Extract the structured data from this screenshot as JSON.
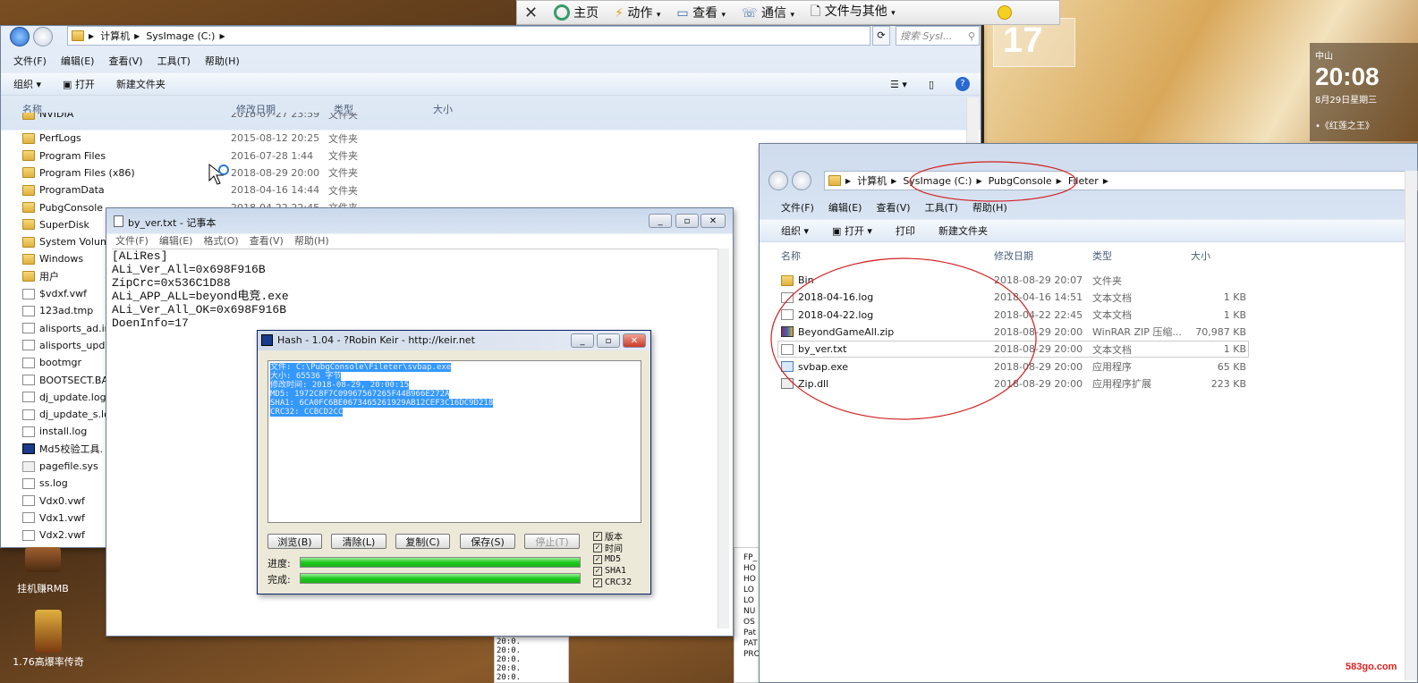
{
  "top_toolbar": {
    "close": "✕",
    "home": "主页",
    "action": "动作",
    "view": "查看",
    "comm": "通信",
    "files_other": "文件与其他"
  },
  "desktop": {
    "clock": "20:08",
    "city": "中山",
    "date": "8月29日星期三",
    "song": "•《红莲之王》",
    "icon1_label": "挂机赚RMB",
    "icon2_label": "1.76高爆率传奇",
    "watermark": "583go.com",
    "partial_number": "17"
  },
  "explorer1": {
    "breadcrumb": [
      "计算机",
      "SysImage (C:)"
    ],
    "search_placeholder": "搜索 SysI...",
    "menu": [
      "文件(F)",
      "编辑(E)",
      "查看(V)",
      "工具(T)",
      "帮助(H)"
    ],
    "toolbar": {
      "organize": "组织 ▾",
      "open": "打开",
      "new_folder": "新建文件夹"
    },
    "columns": {
      "name": "名称",
      "modified": "修改日期",
      "type": "类型",
      "size": "大小"
    },
    "rows": [
      {
        "name": "NVIDIA",
        "date": "2018-07-27 23:59",
        "type": "文件夹",
        "icon": "folder"
      },
      {
        "name": "PerfLogs",
        "date": "2015-08-12 20:25",
        "type": "文件夹",
        "icon": "folder"
      },
      {
        "name": "Program Files",
        "date": "2016-07-28 1:44",
        "type": "文件夹",
        "icon": "folder"
      },
      {
        "name": "Program Files (x86)",
        "date": "2018-08-29 20:00",
        "type": "文件夹",
        "icon": "folder"
      },
      {
        "name": "ProgramData",
        "date": "2018-04-16 14:44",
        "type": "文件夹",
        "icon": "folder"
      },
      {
        "name": "PubgConsole",
        "date": "2018-04-22 22:45",
        "type": "文件夹",
        "icon": "folder"
      },
      {
        "name": "SuperDisk",
        "date": "",
        "type": "",
        "icon": "folder"
      },
      {
        "name": "System Volum",
        "date": "",
        "type": "",
        "icon": "folder"
      },
      {
        "name": "Windows",
        "date": "",
        "type": "",
        "icon": "folder"
      },
      {
        "name": "用户",
        "date": "",
        "type": "",
        "icon": "folder"
      },
      {
        "name": "$vdxf.vwf",
        "date": "",
        "type": "",
        "icon": "file"
      },
      {
        "name": "123ad.tmp",
        "date": "",
        "type": "",
        "icon": "file"
      },
      {
        "name": "alisports_ad.ir",
        "date": "",
        "type": "",
        "icon": "file"
      },
      {
        "name": "alisports_upd",
        "date": "",
        "type": "",
        "icon": "file"
      },
      {
        "name": "bootmgr",
        "date": "",
        "type": "",
        "icon": "file"
      },
      {
        "name": "BOOTSECT.BA",
        "date": "",
        "type": "",
        "icon": "file"
      },
      {
        "name": "dj_update.log",
        "date": "",
        "type": "",
        "icon": "file"
      },
      {
        "name": "dj_update_s.lo",
        "date": "",
        "type": "",
        "icon": "file"
      },
      {
        "name": "install.log",
        "date": "",
        "type": "",
        "icon": "file"
      },
      {
        "name": "Md5校验工具.",
        "date": "",
        "type": "",
        "icon": "md5"
      },
      {
        "name": "pagefile.sys",
        "date": "",
        "type": "",
        "icon": "sys"
      },
      {
        "name": "ss.log",
        "date": "",
        "type": "",
        "icon": "file"
      },
      {
        "name": "Vdx0.vwf",
        "date": "",
        "type": "",
        "icon": "file"
      },
      {
        "name": "Vdx1.vwf",
        "date": "",
        "type": "",
        "icon": "file"
      },
      {
        "name": "Vdx2.vwf",
        "date": "",
        "type": "",
        "icon": "file"
      }
    ]
  },
  "notepad": {
    "title": "by_ver.txt - 记事本",
    "menu": [
      "文件(F)",
      "编辑(E)",
      "格式(O)",
      "查看(V)",
      "帮助(H)"
    ],
    "lines": [
      "[ALiRes]",
      "ALi_Ver_All=0x698F916B",
      "ZipCrc=0x536C1D88",
      "ALi_APP_ALL=beyond电竞.exe",
      "ALi_Ver_All_OK=0x698F916B",
      "DoenInfo=17"
    ]
  },
  "hash": {
    "title": "Hash - 1.04 - ?Robin Keir - http://keir.net",
    "lines": [
      "文件: C:\\PubgConsole\\Fileter\\svbap.exe",
      "大小: 65536 字节",
      "修改时间: 2018-08-29, 20:00:15",
      "MD5: 1972C8F7C09967567265F44B966E272A",
      "SHA1: 6CA0FC6BE0673465261929AB12CEF3C16DC9D218",
      "CRC32: CCBCD2CC"
    ],
    "buttons": {
      "browse": "浏览(B)",
      "clear": "清除(L)",
      "copy": "复制(C)",
      "save": "保存(S)",
      "stop": "停止(T)"
    },
    "checks": [
      "版本",
      "时间",
      "MD5",
      "SHA1",
      "CRC32"
    ],
    "progress_label": "进度:",
    "done_label": "完成:",
    "progress": 1.0,
    "done": 1.0
  },
  "explorer2": {
    "breadcrumb": [
      "计算机",
      "SysImage (C:)",
      "PubgConsole",
      "Fileter"
    ],
    "menu": [
      "文件(F)",
      "编辑(E)",
      "查看(V)",
      "工具(T)",
      "帮助(H)"
    ],
    "toolbar": {
      "organize": "组织 ▾",
      "open": "打开 ▾",
      "print": "打印",
      "new_folder": "新建文件夹"
    },
    "columns": {
      "name": "名称",
      "modified": "修改日期",
      "type": "类型",
      "size": "大小"
    },
    "rows": [
      {
        "name": "Bin",
        "date": "2018-08-29 20:07",
        "type": "文件夹",
        "size": "",
        "icon": "folder"
      },
      {
        "name": "2018-04-16.log",
        "date": "2018-04-16 14:51",
        "type": "文本文档",
        "size": "1 KB",
        "icon": "file"
      },
      {
        "name": "2018-04-22.log",
        "date": "2018-04-22 22:45",
        "type": "文本文档",
        "size": "1 KB",
        "icon": "file"
      },
      {
        "name": "BeyondGameAll.zip",
        "date": "2018-08-29 20:00",
        "type": "WinRAR ZIP 压缩...",
        "size": "70,987 KB",
        "icon": "zip"
      },
      {
        "name": "by_ver.txt",
        "date": "2018-08-29 20:00",
        "type": "文本文档",
        "size": "1 KB",
        "icon": "file"
      },
      {
        "name": "svbap.exe",
        "date": "2018-08-29 20:00",
        "type": "应用程序",
        "size": "65 KB",
        "icon": "exe"
      },
      {
        "name": "Zip.dll",
        "date": "2018-08-29 20:00",
        "type": "应用程序扩展",
        "size": "223 KB",
        "icon": "dll"
      }
    ]
  },
  "background_text": {
    "right_labels": [
      "FP_",
      "HO",
      "HO",
      "LO",
      "LO",
      "NU",
      "OS",
      "Pat",
      "PAT",
      "PRO"
    ],
    "times": [
      "20:0.",
      "20:0.",
      "20:0.",
      "20:0.",
      "20:0."
    ]
  },
  "colors": {
    "annotation_red": "#d22020",
    "selection": "#3399ff",
    "progress_green": "#1ec81e"
  }
}
